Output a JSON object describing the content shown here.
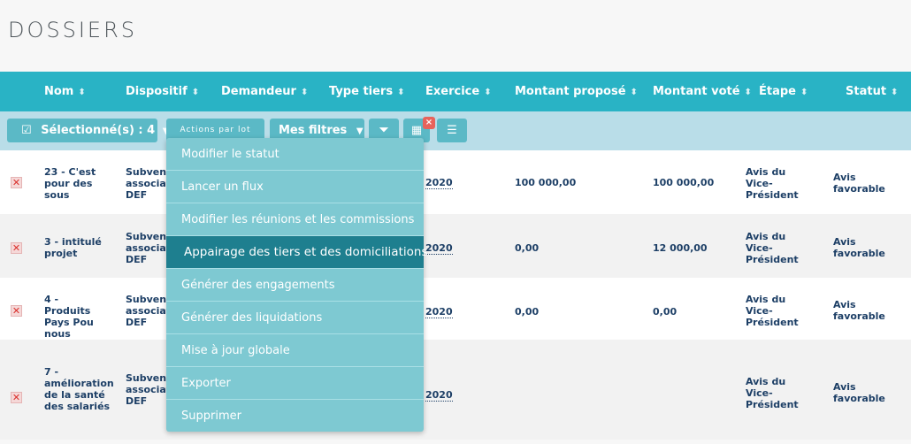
{
  "page": {
    "title": "DOSSIERS"
  },
  "columns": [
    {
      "label": "Nom",
      "sort": "⬍"
    },
    {
      "label": "Dispositif",
      "sort": "⬍"
    },
    {
      "label": "Demandeur",
      "sort": "⬍"
    },
    {
      "label": "Type tiers",
      "sort": "⬍"
    },
    {
      "label": "Exercice",
      "sort": "⬍"
    },
    {
      "label": "Montant proposé",
      "sort": "⬍"
    },
    {
      "label": "Montant voté",
      "sort": "⬍"
    },
    {
      "label": "Étape",
      "sort": "⬍"
    },
    {
      "label": "Statut",
      "sort": "⬍"
    }
  ],
  "toolbar": {
    "selected_label": "Sélectionné(s) : 4",
    "actions_label": "Actions par lot",
    "filters_label": "Mes filtres",
    "close_glyph": "×"
  },
  "rows": [
    {
      "nom": "23 - C'est pour des sous",
      "dispositif": "Subvent associati DEF",
      "exercice": "2020",
      "montant_propose": "100 000,00",
      "montant_vote": "100 000,00",
      "etape": "Avis du Vice-Président",
      "statut": "Avis favorable"
    },
    {
      "nom": "3 - intitulé projet",
      "dispositif": "Subvent associati DEF",
      "exercice": "2020",
      "montant_propose": "0,00",
      "montant_vote": "12 000,00",
      "etape": "Avis du Vice-Président",
      "statut": "Avis favorable"
    },
    {
      "nom": "4 - Produits Pays Pou nous",
      "dispositif": "Subvent associati DEF",
      "exercice": "2020",
      "montant_propose": "0,00",
      "montant_vote": "0,00",
      "etape": "Avis du Vice-Président",
      "statut": "Avis favorable"
    },
    {
      "nom": "7 - amélioration de la santé des salariés",
      "dispositif": "Subvent associati DEF",
      "exercice": "2020",
      "montant_propose": "",
      "montant_vote": "",
      "etape": "Avis du Vice-Président",
      "statut": "Avis favorable"
    }
  ],
  "delete_glyph": "✕",
  "menu": {
    "items": [
      "Modifier le statut",
      "Lancer un flux",
      "Modifier les réunions et les commissions",
      "Appairage des tiers et des domiciliations",
      "Générer des engagements",
      "Générer des liquidations",
      "Mise à jour globale",
      "Exporter",
      "Supprimer"
    ],
    "active_index": 3
  },
  "colors": {
    "header": "#29b3c5",
    "toolbar": "#b9dde8",
    "menu": "#7ec9d2",
    "menu_active": "#1e7f8f",
    "text": "#1d3f66"
  }
}
